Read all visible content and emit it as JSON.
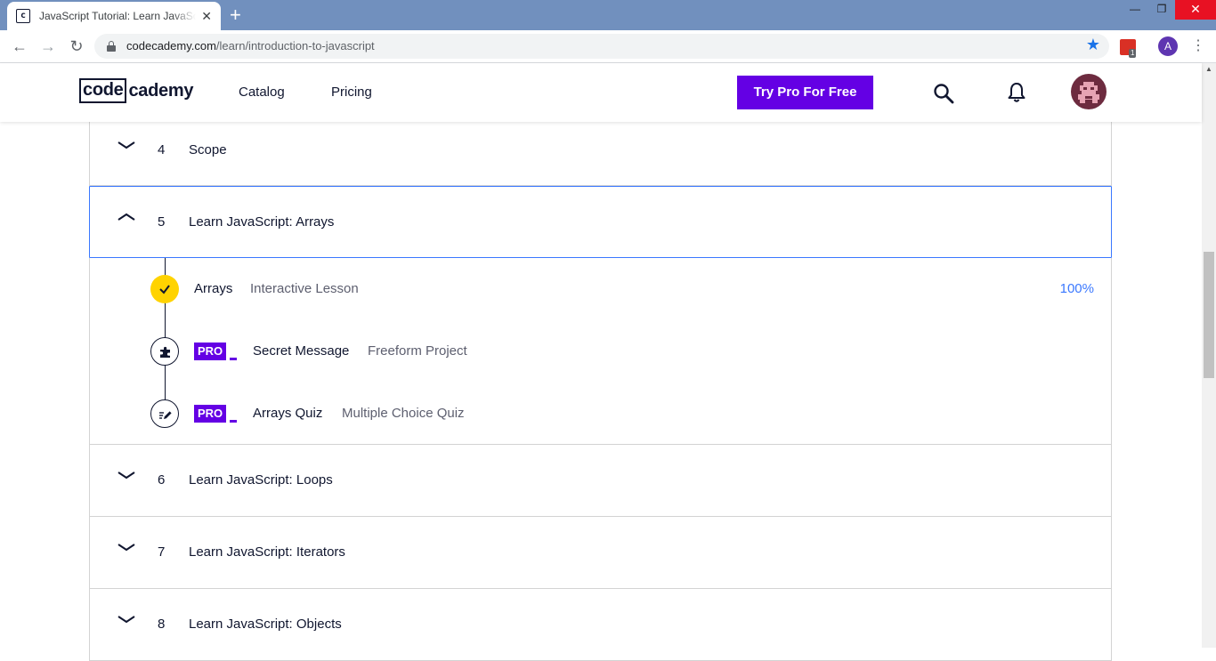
{
  "browser": {
    "tab_title": "JavaScript Tutorial: Learn JavaScript For Free | Codecademy",
    "tab_favicon": "c",
    "tab_close": "✕",
    "new_tab": "+",
    "url_host": "codecademy.com",
    "url_path": "/learn/introduction-to-javascript",
    "profile_initial": "A",
    "extension_badge": "1",
    "window_controls": [
      "—",
      "❐",
      "✕"
    ]
  },
  "header": {
    "logo_box": "code",
    "logo_rest": "cademy",
    "nav": [
      "Catalog",
      "Pricing"
    ],
    "cta_label": "Try Pro For Free"
  },
  "syllabus": {
    "modules_before": [
      {
        "number": "4",
        "title": "Scope",
        "expanded": false
      }
    ],
    "open_module": {
      "number": "5",
      "title": "Learn JavaScript: Arrays",
      "expanded": true
    },
    "lessons": [
      {
        "name": "Arrays",
        "kind": "Interactive Lesson",
        "progress": "100%",
        "pro": false,
        "icon": "checkmark-icon",
        "completed": true
      },
      {
        "name": "Secret Message",
        "kind": "Freeform Project",
        "pro": true,
        "pro_label": "PRO",
        "icon": "puzzle-icon",
        "completed": false
      },
      {
        "name": "Arrays Quiz",
        "kind": "Multiple Choice Quiz",
        "pro": true,
        "pro_label": "PRO",
        "icon": "quiz-pencil-icon",
        "completed": false
      }
    ],
    "modules_after": [
      {
        "number": "6",
        "title": "Learn JavaScript: Loops",
        "expanded": false
      },
      {
        "number": "7",
        "title": "Learn JavaScript: Iterators",
        "expanded": false
      },
      {
        "number": "8",
        "title": "Learn JavaScript: Objects",
        "expanded": false
      }
    ]
  },
  "colors": {
    "brand_purple": "#6400e4",
    "accent_blue": "#3a78ff",
    "check_yellow": "#ffd300",
    "navy": "#10162f"
  }
}
